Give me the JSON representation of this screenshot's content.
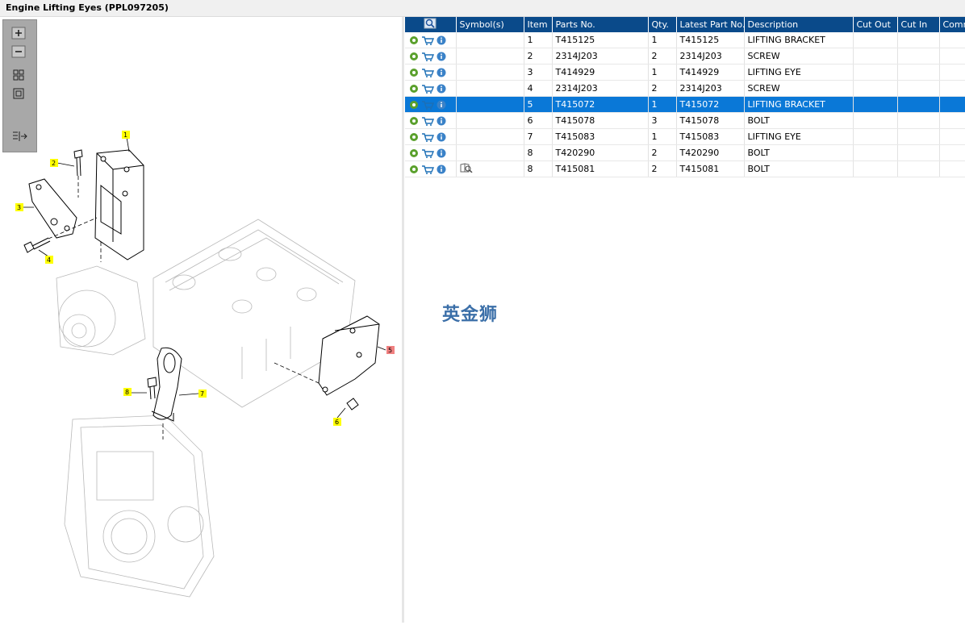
{
  "title": "Engine Lifting Eyes (PPL097205)",
  "watermark": "英金狮",
  "toolbar": {
    "zoom_in_icon": "plus-icon",
    "zoom_out_icon": "minus-icon",
    "fit_icon": "grid-icon",
    "actual_icon": "square-icon",
    "list_icon": "list-arrow-icon"
  },
  "table": {
    "headers": [
      "",
      "Symbol(s)",
      "Item",
      "Parts No.",
      "Qty.",
      "Latest Part No.",
      "Description",
      "Cut Out",
      "Cut In",
      "Comment"
    ],
    "rows": [
      {
        "item": "1",
        "part": "T415125",
        "qty": "1",
        "latest": "T415125",
        "desc": "LIFTING BRACKET",
        "symbol": false,
        "selected": false
      },
      {
        "item": "2",
        "part": "2314J203",
        "qty": "2",
        "latest": "2314J203",
        "desc": "SCREW",
        "symbol": false,
        "selected": false
      },
      {
        "item": "3",
        "part": "T414929",
        "qty": "1",
        "latest": "T414929",
        "desc": "LIFTING EYE",
        "symbol": false,
        "selected": false
      },
      {
        "item": "4",
        "part": "2314J203",
        "qty": "2",
        "latest": "2314J203",
        "desc": "SCREW",
        "symbol": false,
        "selected": false
      },
      {
        "item": "5",
        "part": "T415072",
        "qty": "1",
        "latest": "T415072",
        "desc": "LIFTING BRACKET",
        "symbol": false,
        "selected": true
      },
      {
        "item": "6",
        "part": "T415078",
        "qty": "3",
        "latest": "T415078",
        "desc": "BOLT",
        "symbol": false,
        "selected": false
      },
      {
        "item": "7",
        "part": "T415083",
        "qty": "1",
        "latest": "T415083",
        "desc": "LIFTING EYE",
        "symbol": false,
        "selected": false
      },
      {
        "item": "8",
        "part": "T420290",
        "qty": "2",
        "latest": "T420290",
        "desc": "BOLT",
        "symbol": false,
        "selected": false
      },
      {
        "item": "8",
        "part": "T415081",
        "qty": "2",
        "latest": "T415081",
        "desc": "BOLT",
        "symbol": true,
        "selected": false
      }
    ]
  },
  "callouts": [
    "1",
    "2",
    "3",
    "4",
    "5",
    "6",
    "7",
    "8"
  ],
  "colors": {
    "header": "#0a4a8a",
    "selected": "#0a78d7",
    "callout": "#ffff00",
    "callout_active": "#f08080"
  }
}
